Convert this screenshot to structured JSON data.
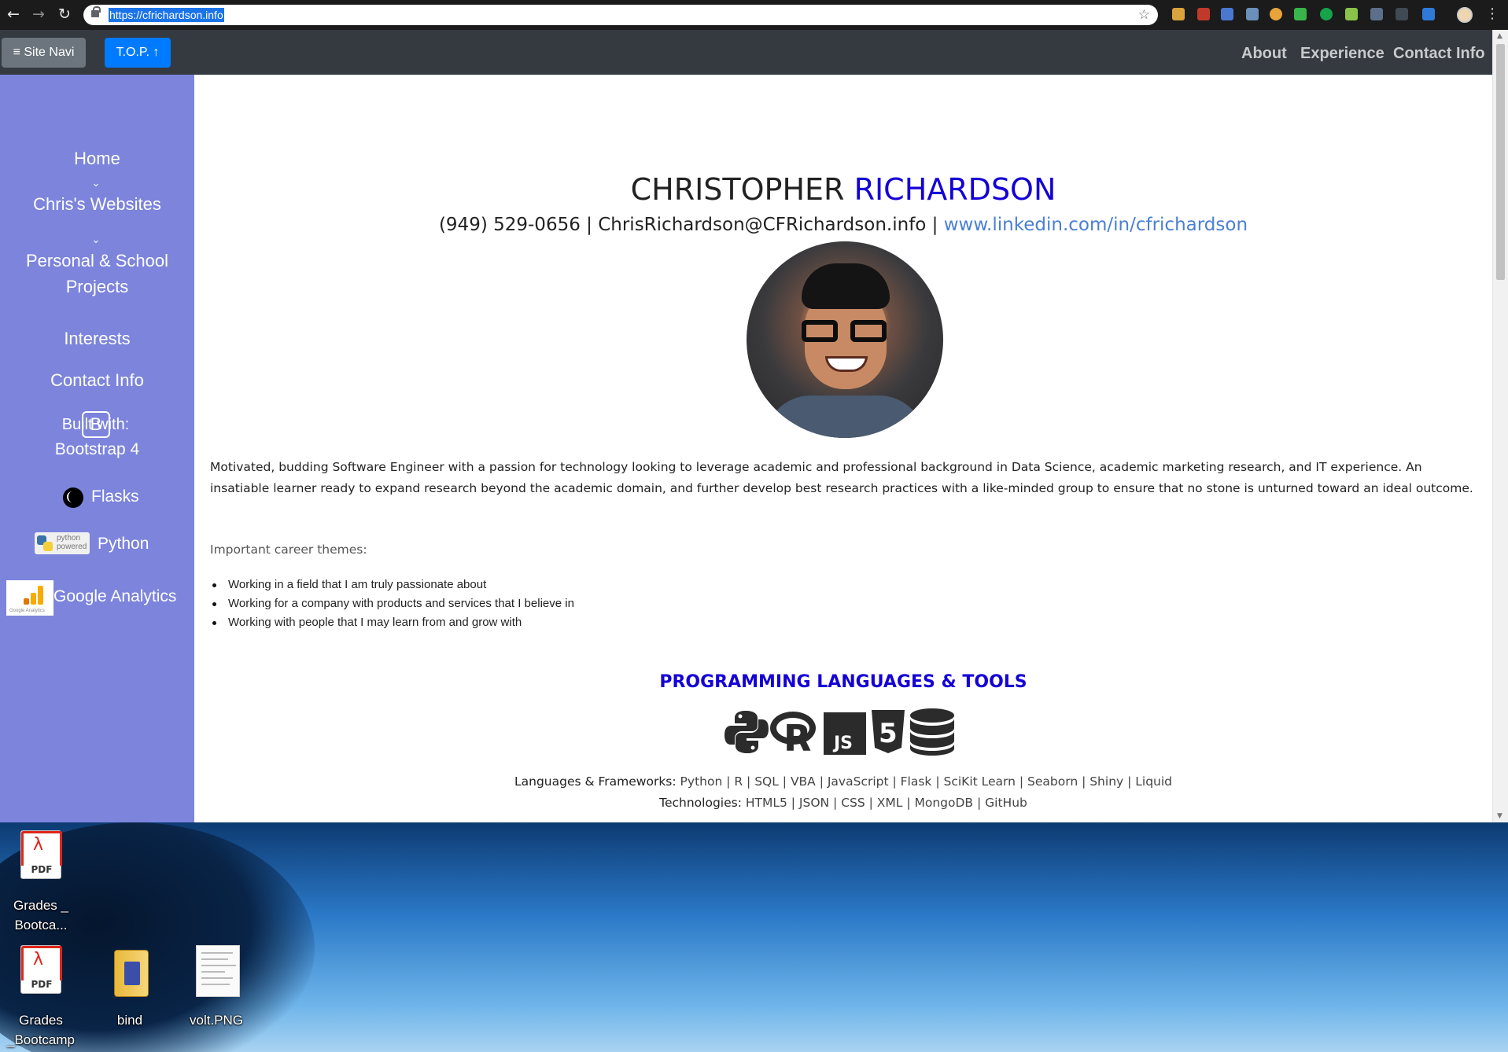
{
  "browser": {
    "url": "https://cfrichardson.info"
  },
  "topnav": {
    "site_navi": "Site Navi",
    "top_button": "T.O.P.",
    "links": [
      "About",
      "Experience",
      "Contact Info"
    ]
  },
  "sidebar": {
    "home": "Home",
    "websites": "Chris's Websites",
    "projects_line1": "Personal & School",
    "projects_line2": "Projects",
    "interests": "Interests",
    "contact": "Contact Info",
    "built_with": "Built with:",
    "bootstrap_badge": "B",
    "bootstrap": "Bootstrap 4",
    "flasks": "Flasks",
    "python": "Python",
    "python_logo_text": "python powered",
    "google_analytics": "Google Analytics",
    "ga_logo_text": "Google Analytics"
  },
  "profile": {
    "first_name": "CHRISTOPHER",
    "last_name": "RICHARDSON",
    "contact_prefix": "(949) 529-0656 | ChrisRichardson@CFRichardson.info | ",
    "linkedin": "www.linkedin.com/in/cfrichardson",
    "summary": "Motivated, budding Software Engineer with a passion for technology looking to leverage academic and professional background in Data Science, academic marketing research, and IT experience. An insatiable learner ready to expand research beyond the academic domain, and further develop best research practices with a like-minded group to ensure that no stone is unturned toward an ideal outcome.",
    "themes_title": "Important career themes:",
    "themes": [
      "Working in a field that I am truly passionate about",
      "Working for a company with products and services that I believe in",
      "Working with people that I may learn from and grow with"
    ]
  },
  "tools": {
    "title": "PROGRAMMING LANGUAGES & TOOLS",
    "icons": [
      "python-icon",
      "r-icon",
      "javascript-icon",
      "html5-icon",
      "database-icon"
    ],
    "icon_labels": {
      "r": "R",
      "js": "JS",
      "html5": "5"
    },
    "languages_label": "Languages & Frameworks:",
    "languages": "Python | R | SQL | VBA | JavaScript | Flask | SciKit Learn | Seaborn | Shiny | Liquid",
    "technologies_label": "Technologies:",
    "technologies": "HTML5 | JSON | CSS | XML | MongoDB | GitHub"
  },
  "desktop": {
    "icons": [
      {
        "label_line1": "Grades _",
        "label_line2": "Bootca...",
        "type": "pdf"
      },
      {
        "label_line1": "Grades",
        "label_line2": "_Bootcamp ...",
        "type": "pdf"
      },
      {
        "label_line1": "bind",
        "label_line2": "",
        "type": "folder"
      },
      {
        "label_line1": "volt.PNG",
        "label_line2": "",
        "type": "image"
      }
    ],
    "pdf_text": "PDF"
  },
  "colors": {
    "sidebar": "#7c84dc",
    "topnav": "#343a40",
    "accent_blue": "#1400d6",
    "link_blue": "#4a7fd4",
    "top_button": "#007bff"
  }
}
